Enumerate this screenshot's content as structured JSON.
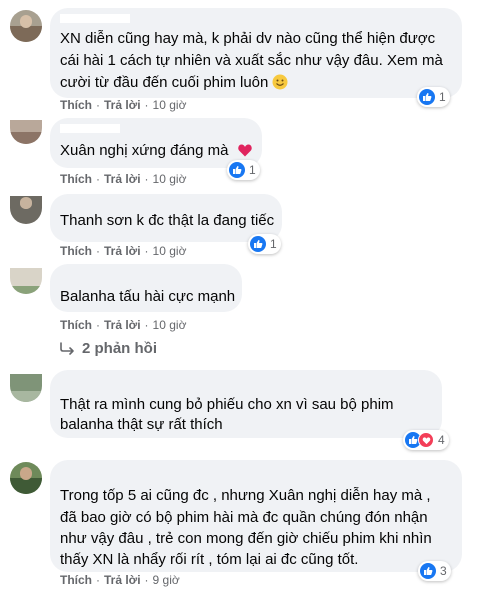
{
  "comments": [
    {
      "name_fragment": "",
      "lines": [
        "XN diễn cũng hay mà, k phải dv nào cũng thể hiện được",
        "cái hài 1 cách tự nhiên và xuất sắc như vậy đâu. Xem mà",
        "cười từ đầu đến cuối phim luôn"
      ],
      "emoji": "smiling-face",
      "like_label": "Thích",
      "reply_label": "Trả lời",
      "time": "10 giờ",
      "reaction_count": "1"
    },
    {
      "name_fragment": "",
      "lines": [
        "Xuân nghị xứng đáng mà"
      ],
      "emoji": "red-heart",
      "like_label": "Thích",
      "reply_label": "Trả lời",
      "time": "10 giờ",
      "reaction_count": "1"
    },
    {
      "name_fragment": "",
      "lines": [
        "Thanh sơn k đc thật la đang tiếc"
      ],
      "like_label": "Thích",
      "reply_label": "Trả lời",
      "time": "10 giờ",
      "reaction_count": "1"
    },
    {
      "name_fragment": "",
      "lines": [
        "Balanha tấu hài cực mạnh"
      ],
      "like_label": "Thích",
      "reply_label": "Trả lời",
      "time": "10 giờ",
      "replies_label": "2 phản hồi"
    },
    {
      "name_fragment": "",
      "lines": [
        "Thật ra mình cung bỏ phiếu cho xn vì sau bộ phim",
        "balanha thật sự rất thích"
      ],
      "reaction_count": "4"
    },
    {
      "name_fragment": "",
      "lines": [
        "Trong tốp 5 ai cũng đc , nhưng Xuân nghị diễn hay mà ,",
        "đã bao giờ có bộ phim hài mà đc quần chúng đón nhận",
        "như vậy đâu , trẻ con mong đến giờ chiếu phim khi nhìn",
        "thấy XN là nhẩy rối rít , tóm lại ai đc cũng tốt."
      ],
      "like_label": "Thích",
      "reply_label": "Trả lời",
      "time": "9 giờ",
      "reaction_count": "3"
    }
  ],
  "colors": {
    "bubble": "#f0f2f5",
    "like_blue": "#1877f2",
    "heart_red": "#f33e58",
    "meta_gray": "#65676b"
  },
  "icons": {
    "like": "thumbs-up-icon",
    "love": "heart-icon",
    "replies": "reply-arrow-icon"
  }
}
